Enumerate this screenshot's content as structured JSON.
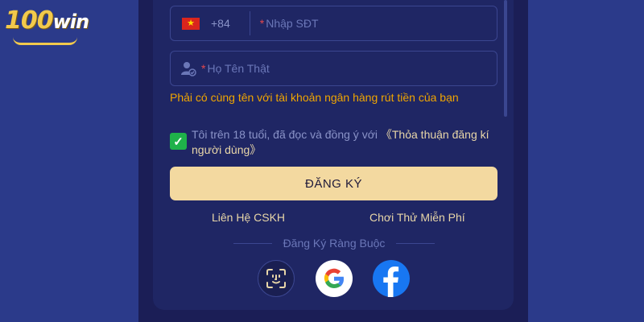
{
  "logo": {
    "main": "100",
    "suffix": "win"
  },
  "phone_field": {
    "country_code": "+84",
    "required_mark": "*",
    "placeholder": "Nhập SĐT"
  },
  "name_field": {
    "required_mark": "*",
    "placeholder": "Họ Tên Thật"
  },
  "name_hint": "Phải có cùng tên với tài khoản ngân hàng rút tiền của bạn",
  "agreement": {
    "checked": true,
    "text": "Tôi trên 18 tuổi, đã đọc và đồng ý với",
    "link": "《Thỏa thuận đăng kí người dùng》"
  },
  "register_button": "ĐĂNG KÝ",
  "links": {
    "support": "Liên Hệ CSKH",
    "trial": "Chơi Thử Miễn Phí"
  },
  "bind_section": {
    "label": "Đăng Ký Ràng Buộc"
  },
  "social_icons": [
    "face-id-icon",
    "google-icon",
    "facebook-icon"
  ],
  "colors": {
    "background": "#2b3a8a",
    "card": "#1f2664",
    "accent_gold": "#f3d9a0",
    "hint_orange": "#f0a500",
    "check_green": "#1fb24a",
    "facebook_blue": "#1877f2"
  }
}
